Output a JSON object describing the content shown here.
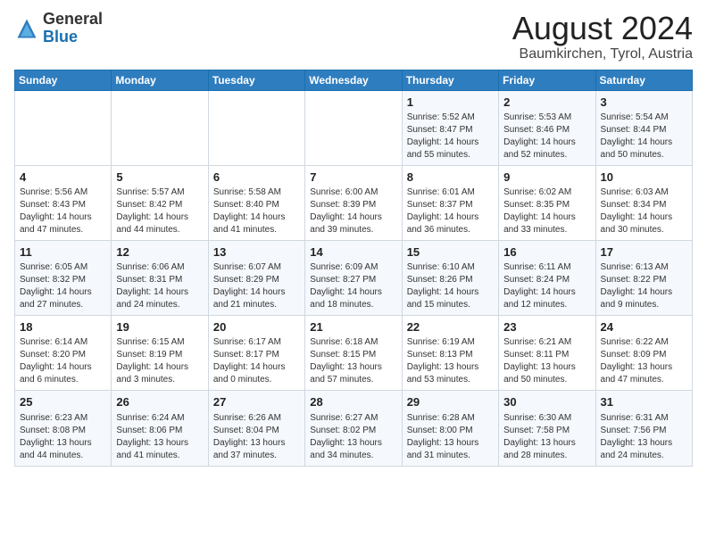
{
  "logo": {
    "general": "General",
    "blue": "Blue"
  },
  "title": "August 2024",
  "location": "Baumkirchen, Tyrol, Austria",
  "days_header": [
    "Sunday",
    "Monday",
    "Tuesday",
    "Wednesday",
    "Thursday",
    "Friday",
    "Saturday"
  ],
  "weeks": [
    [
      {
        "num": "",
        "sunrise": "",
        "sunset": "",
        "daylight": ""
      },
      {
        "num": "",
        "sunrise": "",
        "sunset": "",
        "daylight": ""
      },
      {
        "num": "",
        "sunrise": "",
        "sunset": "",
        "daylight": ""
      },
      {
        "num": "",
        "sunrise": "",
        "sunset": "",
        "daylight": ""
      },
      {
        "num": "1",
        "sunrise": "Sunrise: 5:52 AM",
        "sunset": "Sunset: 8:47 PM",
        "daylight": "Daylight: 14 hours and 55 minutes."
      },
      {
        "num": "2",
        "sunrise": "Sunrise: 5:53 AM",
        "sunset": "Sunset: 8:46 PM",
        "daylight": "Daylight: 14 hours and 52 minutes."
      },
      {
        "num": "3",
        "sunrise": "Sunrise: 5:54 AM",
        "sunset": "Sunset: 8:44 PM",
        "daylight": "Daylight: 14 hours and 50 minutes."
      }
    ],
    [
      {
        "num": "4",
        "sunrise": "Sunrise: 5:56 AM",
        "sunset": "Sunset: 8:43 PM",
        "daylight": "Daylight: 14 hours and 47 minutes."
      },
      {
        "num": "5",
        "sunrise": "Sunrise: 5:57 AM",
        "sunset": "Sunset: 8:42 PM",
        "daylight": "Daylight: 14 hours and 44 minutes."
      },
      {
        "num": "6",
        "sunrise": "Sunrise: 5:58 AM",
        "sunset": "Sunset: 8:40 PM",
        "daylight": "Daylight: 14 hours and 41 minutes."
      },
      {
        "num": "7",
        "sunrise": "Sunrise: 6:00 AM",
        "sunset": "Sunset: 8:39 PM",
        "daylight": "Daylight: 14 hours and 39 minutes."
      },
      {
        "num": "8",
        "sunrise": "Sunrise: 6:01 AM",
        "sunset": "Sunset: 8:37 PM",
        "daylight": "Daylight: 14 hours and 36 minutes."
      },
      {
        "num": "9",
        "sunrise": "Sunrise: 6:02 AM",
        "sunset": "Sunset: 8:35 PM",
        "daylight": "Daylight: 14 hours and 33 minutes."
      },
      {
        "num": "10",
        "sunrise": "Sunrise: 6:03 AM",
        "sunset": "Sunset: 8:34 PM",
        "daylight": "Daylight: 14 hours and 30 minutes."
      }
    ],
    [
      {
        "num": "11",
        "sunrise": "Sunrise: 6:05 AM",
        "sunset": "Sunset: 8:32 PM",
        "daylight": "Daylight: 14 hours and 27 minutes."
      },
      {
        "num": "12",
        "sunrise": "Sunrise: 6:06 AM",
        "sunset": "Sunset: 8:31 PM",
        "daylight": "Daylight: 14 hours and 24 minutes."
      },
      {
        "num": "13",
        "sunrise": "Sunrise: 6:07 AM",
        "sunset": "Sunset: 8:29 PM",
        "daylight": "Daylight: 14 hours and 21 minutes."
      },
      {
        "num": "14",
        "sunrise": "Sunrise: 6:09 AM",
        "sunset": "Sunset: 8:27 PM",
        "daylight": "Daylight: 14 hours and 18 minutes."
      },
      {
        "num": "15",
        "sunrise": "Sunrise: 6:10 AM",
        "sunset": "Sunset: 8:26 PM",
        "daylight": "Daylight: 14 hours and 15 minutes."
      },
      {
        "num": "16",
        "sunrise": "Sunrise: 6:11 AM",
        "sunset": "Sunset: 8:24 PM",
        "daylight": "Daylight: 14 hours and 12 minutes."
      },
      {
        "num": "17",
        "sunrise": "Sunrise: 6:13 AM",
        "sunset": "Sunset: 8:22 PM",
        "daylight": "Daylight: 14 hours and 9 minutes."
      }
    ],
    [
      {
        "num": "18",
        "sunrise": "Sunrise: 6:14 AM",
        "sunset": "Sunset: 8:20 PM",
        "daylight": "Daylight: 14 hours and 6 minutes."
      },
      {
        "num": "19",
        "sunrise": "Sunrise: 6:15 AM",
        "sunset": "Sunset: 8:19 PM",
        "daylight": "Daylight: 14 hours and 3 minutes."
      },
      {
        "num": "20",
        "sunrise": "Sunrise: 6:17 AM",
        "sunset": "Sunset: 8:17 PM",
        "daylight": "Daylight: 14 hours and 0 minutes."
      },
      {
        "num": "21",
        "sunrise": "Sunrise: 6:18 AM",
        "sunset": "Sunset: 8:15 PM",
        "daylight": "Daylight: 13 hours and 57 minutes."
      },
      {
        "num": "22",
        "sunrise": "Sunrise: 6:19 AM",
        "sunset": "Sunset: 8:13 PM",
        "daylight": "Daylight: 13 hours and 53 minutes."
      },
      {
        "num": "23",
        "sunrise": "Sunrise: 6:21 AM",
        "sunset": "Sunset: 8:11 PM",
        "daylight": "Daylight: 13 hours and 50 minutes."
      },
      {
        "num": "24",
        "sunrise": "Sunrise: 6:22 AM",
        "sunset": "Sunset: 8:09 PM",
        "daylight": "Daylight: 13 hours and 47 minutes."
      }
    ],
    [
      {
        "num": "25",
        "sunrise": "Sunrise: 6:23 AM",
        "sunset": "Sunset: 8:08 PM",
        "daylight": "Daylight: 13 hours and 44 minutes."
      },
      {
        "num": "26",
        "sunrise": "Sunrise: 6:24 AM",
        "sunset": "Sunset: 8:06 PM",
        "daylight": "Daylight: 13 hours and 41 minutes."
      },
      {
        "num": "27",
        "sunrise": "Sunrise: 6:26 AM",
        "sunset": "Sunset: 8:04 PM",
        "daylight": "Daylight: 13 hours and 37 minutes."
      },
      {
        "num": "28",
        "sunrise": "Sunrise: 6:27 AM",
        "sunset": "Sunset: 8:02 PM",
        "daylight": "Daylight: 13 hours and 34 minutes."
      },
      {
        "num": "29",
        "sunrise": "Sunrise: 6:28 AM",
        "sunset": "Sunset: 8:00 PM",
        "daylight": "Daylight: 13 hours and 31 minutes."
      },
      {
        "num": "30",
        "sunrise": "Sunrise: 6:30 AM",
        "sunset": "Sunset: 7:58 PM",
        "daylight": "Daylight: 13 hours and 28 minutes."
      },
      {
        "num": "31",
        "sunrise": "Sunrise: 6:31 AM",
        "sunset": "Sunset: 7:56 PM",
        "daylight": "Daylight: 13 hours and 24 minutes."
      }
    ]
  ]
}
